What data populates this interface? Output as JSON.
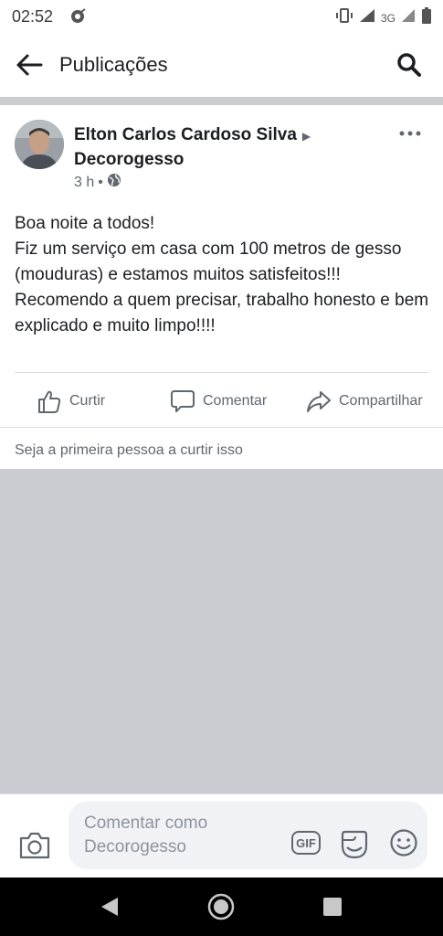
{
  "status_bar": {
    "time": "02:52",
    "network": "3G",
    "icons": [
      "notification-icon",
      "vibrate-icon",
      "signal-icon",
      "battery-icon"
    ]
  },
  "app_bar": {
    "title": "Publicações",
    "back_icon": "arrow-back-icon",
    "search_icon": "search-icon"
  },
  "post": {
    "author_name": "Elton Carlos Cardoso Silva",
    "target_page": "Decorogesso",
    "time": "3 h",
    "separator": "•",
    "privacy_icon": "globe-icon",
    "more_icon": "more-horizontal-icon",
    "text_lines": [
      "Boa noite a todos!",
      "Fiz um serviço em casa com 100 metros de gesso (mouduras) e estamos muitos satisfeitos!!!",
      "Recomendo a quem precisar, trabalho honesto e bem explicado e muito limpo!!!!"
    ],
    "actions": {
      "like": "Curtir",
      "comment": "Comentar",
      "share": "Compartilhar"
    },
    "likes_summary": "Seja a primeira pessoa a curtir isso"
  },
  "composer": {
    "placeholder": "Comentar como Decorogesso",
    "icons": [
      "camera-icon",
      "gif-icon",
      "sticker-icon",
      "emoji-icon"
    ]
  },
  "nav": {
    "icons": [
      "nav-back-icon",
      "nav-home-icon",
      "nav-recents-icon"
    ]
  },
  "colors": {
    "text_primary": "#1c1e21",
    "text_secondary": "#606770",
    "divider": "#dadde1",
    "grey_fill": "#c9ccd1",
    "input_bg": "#f0f2f5",
    "nav_bar": "#000000"
  }
}
